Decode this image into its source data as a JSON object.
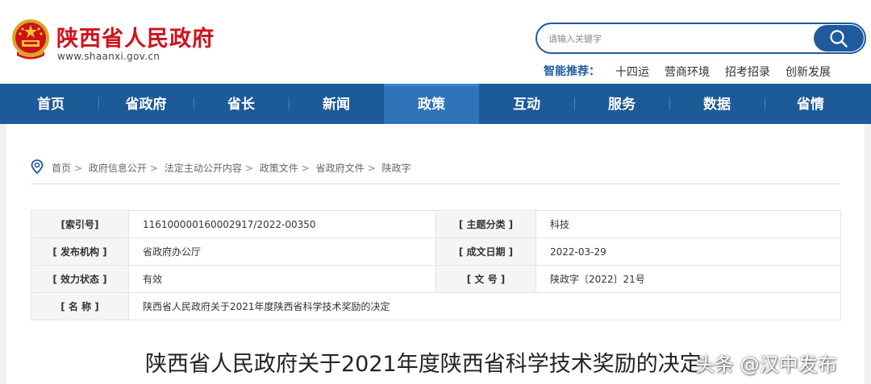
{
  "header": {
    "site_title": "陕西省人民政府",
    "site_domain": "www.shaanxi.gov.cn",
    "search_placeholder": "请输入关键字",
    "smart_label": "智能推荐：",
    "smart_items": [
      "十四运",
      "营商环境",
      "招考招录",
      "创新发展"
    ]
  },
  "nav": {
    "items": [
      "首页",
      "省政府",
      "省长",
      "新闻",
      "政策",
      "互动",
      "服务",
      "数据",
      "省情"
    ],
    "active": "政策"
  },
  "breadcrumb": [
    "首页",
    "政府信息公开",
    "法定主动公开内容",
    "政策文件",
    "省政府文件",
    "陕政字"
  ],
  "meta": {
    "index_label": "[索引号]",
    "index_value": "116100000160002917/2022-00350",
    "topic_label": "[ 主题分类 ]",
    "topic_value": "科技",
    "org_label": "[ 发布机构 ]",
    "org_value": "省政府办公厅",
    "date_label": "[ 成文日期 ]",
    "date_value": "2022-03-29",
    "status_label": "[ 效力状态 ]",
    "status_value": "有效",
    "docno_label": "[ 文 号 ]",
    "docno_value": "陕政字〔2022〕21号",
    "name_label": "[ 名 称 ]",
    "name_value": "陕西省人民政府关于2021年度陕西省科学技术奖励的决定"
  },
  "document_title": "陕西省人民政府关于2021年度陕西省科学技术奖励的决定",
  "watermark": "头条 @汉中发布",
  "colors": {
    "brand_red": "#d0121b",
    "nav_blue": "#1d5a98",
    "nav_active": "#2f73b8"
  }
}
